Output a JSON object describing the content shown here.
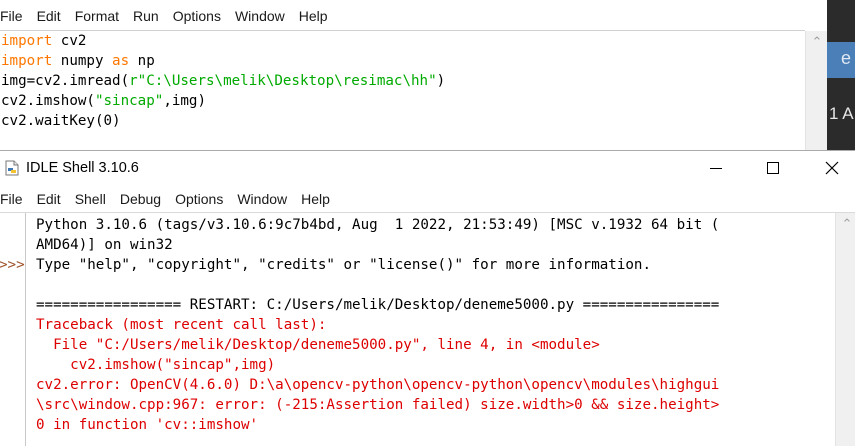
{
  "editor": {
    "menu": [
      "File",
      "Edit",
      "Format",
      "Run",
      "Options",
      "Window",
      "Help"
    ],
    "code": {
      "l1_kw": "import",
      "l1_rest": " cv2",
      "l2_kw": "import",
      "l2_mid": " numpy ",
      "l2_kw2": "as",
      "l2_rest": " np",
      "l3_pre": "img=cv2.imread(",
      "l3_str": "r\"C:\\Users\\melik\\Desktop\\resimac\\hh\"",
      "l3_post": ")",
      "l4_pre": "cv2.imshow(",
      "l4_str": "\"sincap\"",
      "l4_post": ",img)",
      "l5": "cv2.waitKey(0)"
    }
  },
  "side": {
    "blue_text": "e",
    "dark_text": "1 A"
  },
  "shell": {
    "title": "IDLE Shell 3.10.6",
    "menu": [
      "File",
      "Edit",
      "Shell",
      "Debug",
      "Options",
      "Window",
      "Help"
    ],
    "prompt": ">>>",
    "lines": {
      "banner1": "Python 3.10.6 (tags/v3.10.6:9c7b4bd, Aug  1 2022, 21:53:49) [MSC v.1932 64 bit (",
      "banner2": "AMD64)] on win32",
      "banner3": "Type \"help\", \"copyright\", \"credits\" or \"license()\" for more information.",
      "restart": "================= RESTART: C:/Users/melik/Desktop/deneme5000.py ================",
      "tb1": "Traceback (most recent call last):",
      "tb2": "  File \"C:/Users/melik/Desktop/deneme5000.py\", line 4, in <module>",
      "tb3": "    cv2.imshow(\"sincap\",img)",
      "tb4": "cv2.error: OpenCV(4.6.0) D:\\a\\opencv-python\\opencv-python\\opencv\\modules\\highgui",
      "tb5": "\\src\\window.cpp:967: error: (-215:Assertion failed) size.width>0 && size.height>",
      "tb6": "0 in function 'cv::imshow'"
    }
  },
  "colors": {
    "keyword": "#ff7700",
    "string": "#00aa00",
    "error": "#dd0000",
    "prompt": "#a0522d"
  },
  "icons": [
    "idle-app-icon",
    "minimize-icon",
    "maximize-icon",
    "close-icon",
    "scroll-up-icon"
  ]
}
